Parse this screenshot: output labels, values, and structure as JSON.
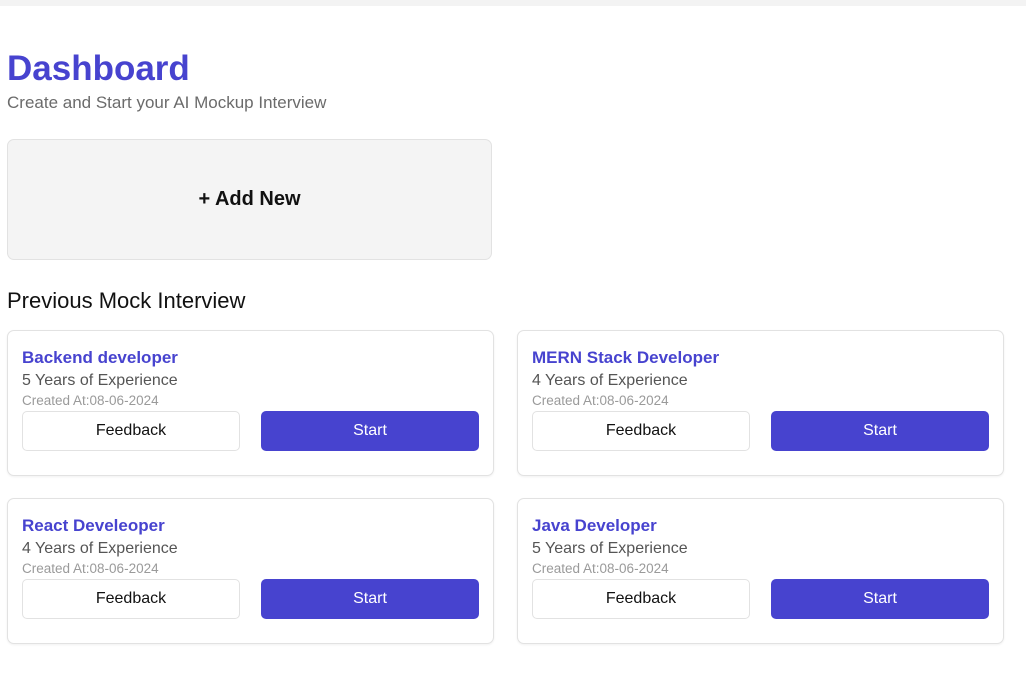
{
  "header": {
    "title": "Dashboard",
    "subtitle": "Create and Start your AI Mockup Interview"
  },
  "add_new": {
    "label": "+ Add New"
  },
  "section": {
    "title": "Previous Mock Interview"
  },
  "interviews": [
    {
      "role": "Backend developer",
      "experience": "5 Years of Experience",
      "created": "Created At:08-06-2024",
      "feedback_label": "Feedback",
      "start_label": "Start"
    },
    {
      "role": "MERN Stack Developer",
      "experience": "4 Years of Experience",
      "created": "Created At:08-06-2024",
      "feedback_label": "Feedback",
      "start_label": "Start"
    },
    {
      "role": "React Develeoper",
      "experience": "4 Years of Experience",
      "created": "Created At:08-06-2024",
      "feedback_label": "Feedback",
      "start_label": "Start"
    },
    {
      "role": "Java Developer",
      "experience": "5 Years of Experience",
      "created": "Created At:08-06-2024",
      "feedback_label": "Feedback",
      "start_label": "Start"
    }
  ],
  "colors": {
    "accent": "#4743cf",
    "muted_text": "#6b6b6b",
    "card_border": "#e2e2e2",
    "add_new_bg": "#f4f4f4"
  }
}
